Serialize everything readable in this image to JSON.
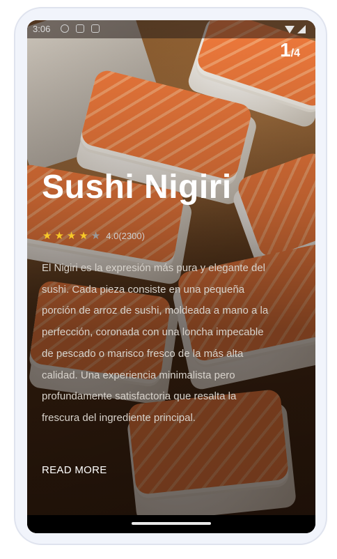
{
  "status_bar": {
    "time": "3:06",
    "left_icons": [
      "play-icon",
      "usb-icon",
      "text-icon"
    ],
    "right_icons": [
      "wifi-icon",
      "signal-icon"
    ]
  },
  "pager": {
    "current": "1",
    "total": "/4"
  },
  "dish": {
    "title": "Sushi Nigiri",
    "rating_value": 4.0,
    "rating_text": "4.0(2300)",
    "stars_total": 5,
    "description": "El Nigiri es la expresión más pura y elegante del sushi. Cada pieza consiste en una pequeña porción de arroz de sushi, moldeada a mano a la perfección, coronada con una loncha impecable de pescado o marisco fresco de la más alta calidad. Una experiencia minimalista pero profundamente satisfactoria que resalta la frescura del ingrediente principal.",
    "read_more_label": "READ MORE"
  },
  "colors": {
    "star_filled": "#f7c928",
    "star_empty": "#9a9a9a",
    "title": "#ffffff"
  }
}
